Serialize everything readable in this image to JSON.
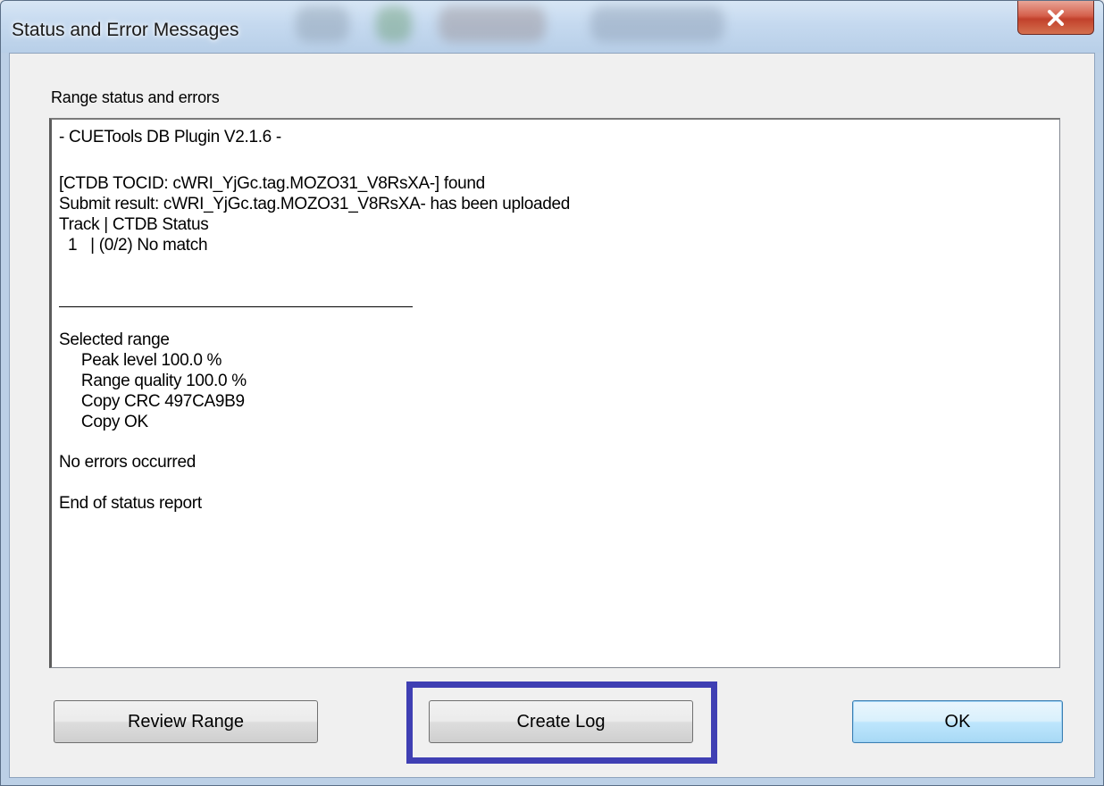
{
  "window": {
    "title": "Status and Error Messages"
  },
  "group": {
    "label": "Range status and errors"
  },
  "log": {
    "lines": [
      "- CUETools DB Plugin V2.1.6 -",
      "[CTDB TOCID: cWRI_YjGc.tag.MOZO31_V8RsXA-] found",
      "Submit result: cWRI_YjGc.tag.MOZO31_V8RsXA- has been uploaded",
      "Track | CTDB Status",
      "  1   | (0/2) No match",
      "Selected range",
      "     Peak level 100.0 %",
      "     Range quality 100.0 %",
      "     Copy CRC 497CA9B9",
      "     Copy OK",
      "No errors occurred",
      "End of status report"
    ]
  },
  "buttons": {
    "review_range": "Review Range",
    "create_log": "Create Log",
    "ok": "OK"
  },
  "icons": {
    "close": "close-icon"
  },
  "colors": {
    "highlight": "#3f3fb3",
    "close_button": "#c2412c",
    "default_button_border": "#3c7fb1"
  }
}
